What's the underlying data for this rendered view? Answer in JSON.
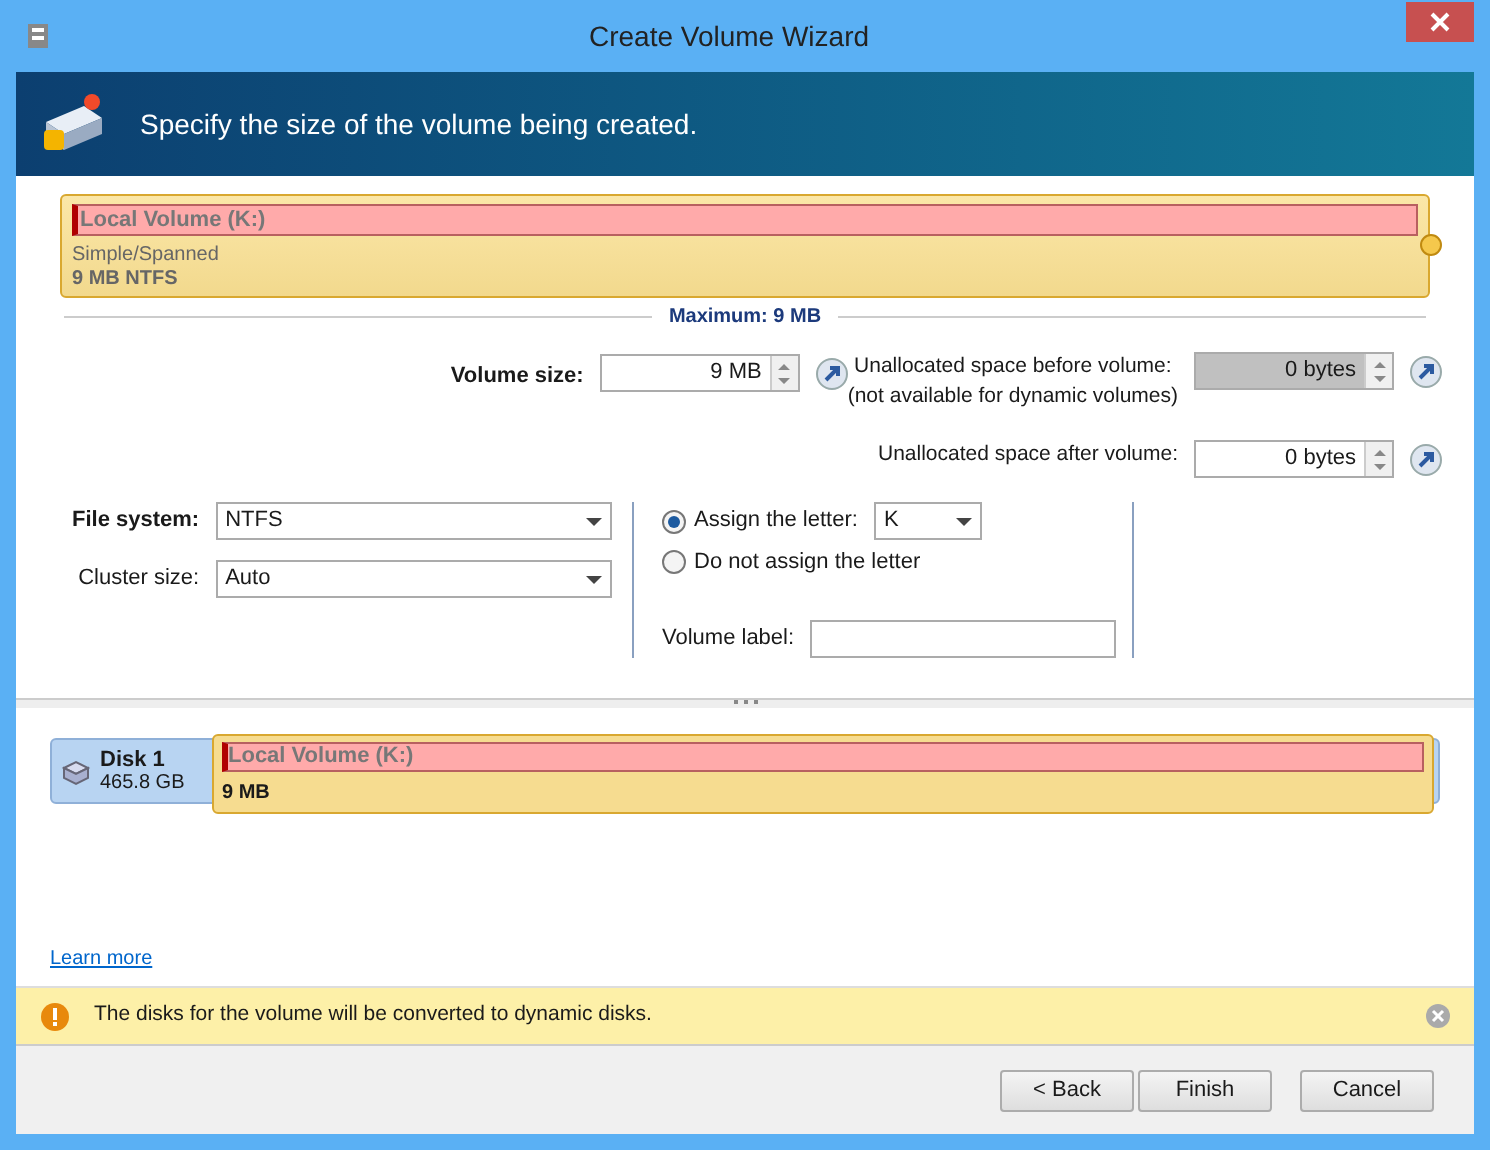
{
  "window": {
    "title": "Create Volume Wizard"
  },
  "header": {
    "text": "Specify the size of the volume being created."
  },
  "volume_bar": {
    "name": "Local Volume (K:)",
    "type": "Simple/Spanned",
    "size": "9 MB NTFS",
    "maximum": "Maximum: 9 MB"
  },
  "size_fields": [
    {
      "label": "Volume size:",
      "value": "9 MB",
      "disabled": false,
      "bold": true
    },
    {
      "label": "Unallocated space before volume:",
      "note": "(not available for dynamic volumes)",
      "value": "0 bytes",
      "disabled": true,
      "bold": false
    },
    {
      "label": "Unallocated space after volume:",
      "value": "0 bytes",
      "disabled": false,
      "bold": false
    }
  ],
  "format": [
    {
      "label": "File system:",
      "value": "NTFS",
      "bold": true
    },
    {
      "label": "Cluster size:",
      "value": "Auto",
      "bold": false
    }
  ],
  "letter_options": [
    {
      "label": "Assign the letter:",
      "selected": true,
      "letter": "K"
    },
    {
      "label": "Do not assign the letter",
      "selected": false
    }
  ],
  "volume_label": {
    "label": "Volume label:"
  },
  "disk": {
    "name": "Disk 1",
    "capacity": "465.8 GB",
    "volume_name": "Local Volume (K:)",
    "volume_size": "9 MB"
  },
  "link": "Learn more",
  "warning": "The disks for the volume will be converted to dynamic disks.",
  "buttons": [
    "< Back",
    "Finish",
    "Cancel"
  ]
}
